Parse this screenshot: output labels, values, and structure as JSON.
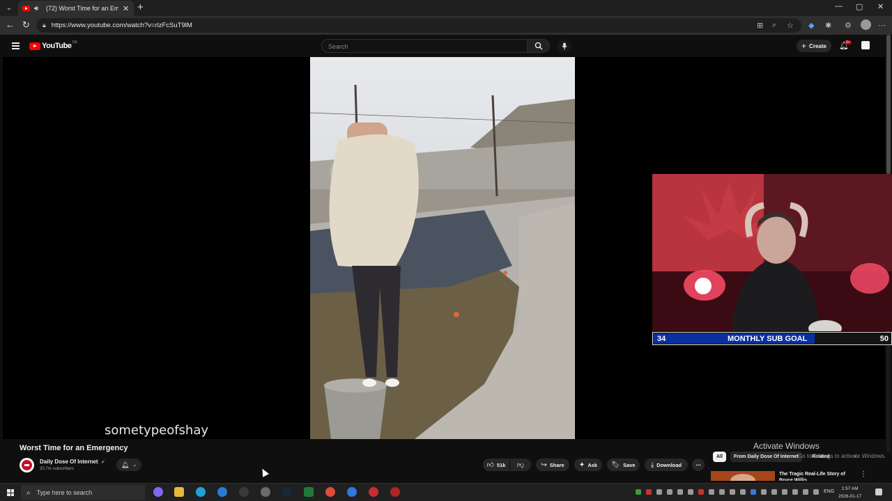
{
  "browser": {
    "tab_title": "(72) Worst Time for an Emer",
    "url": "https://www.youtube.com/watch?v=rlzFcSuT9lM"
  },
  "youtube": {
    "logo_text": "YouTube",
    "logo_region": "CA",
    "search_placeholder": "Search",
    "create_label": "Create",
    "notification_count": "9+"
  },
  "video": {
    "overlay_text": "sometypeofshay",
    "title": "Worst Time for an Emergency",
    "channel_name": "Daily Dose Of Internet",
    "channel_subs": "20.7m subscribers",
    "likes": "51k",
    "share_label": "Share",
    "ask_label": "Ask",
    "save_label": "Save",
    "download_label": "Download"
  },
  "sub_goal": {
    "current": "34",
    "label": "MONTHLY SUB GOAL",
    "target": "50",
    "progress": 0.68
  },
  "recommendations": {
    "chips": [
      "All",
      "From Daily Dose Of Internet",
      "Related"
    ],
    "first_title": "The Tragic Real-Life Story of Bruce Willis"
  },
  "windows_watermark": {
    "line1": "Activate Windows",
    "line2": "Go to Settings to activate Windows."
  },
  "taskbar": {
    "search_placeholder": "Type here to search",
    "language": "ENG",
    "time": "1:57 AM",
    "date": "2026-01-17"
  },
  "colors": {
    "youtube_red": "#ff0000",
    "sub_goal_fill": "#0a2fa0",
    "page_bg": "#0f0f0f"
  }
}
